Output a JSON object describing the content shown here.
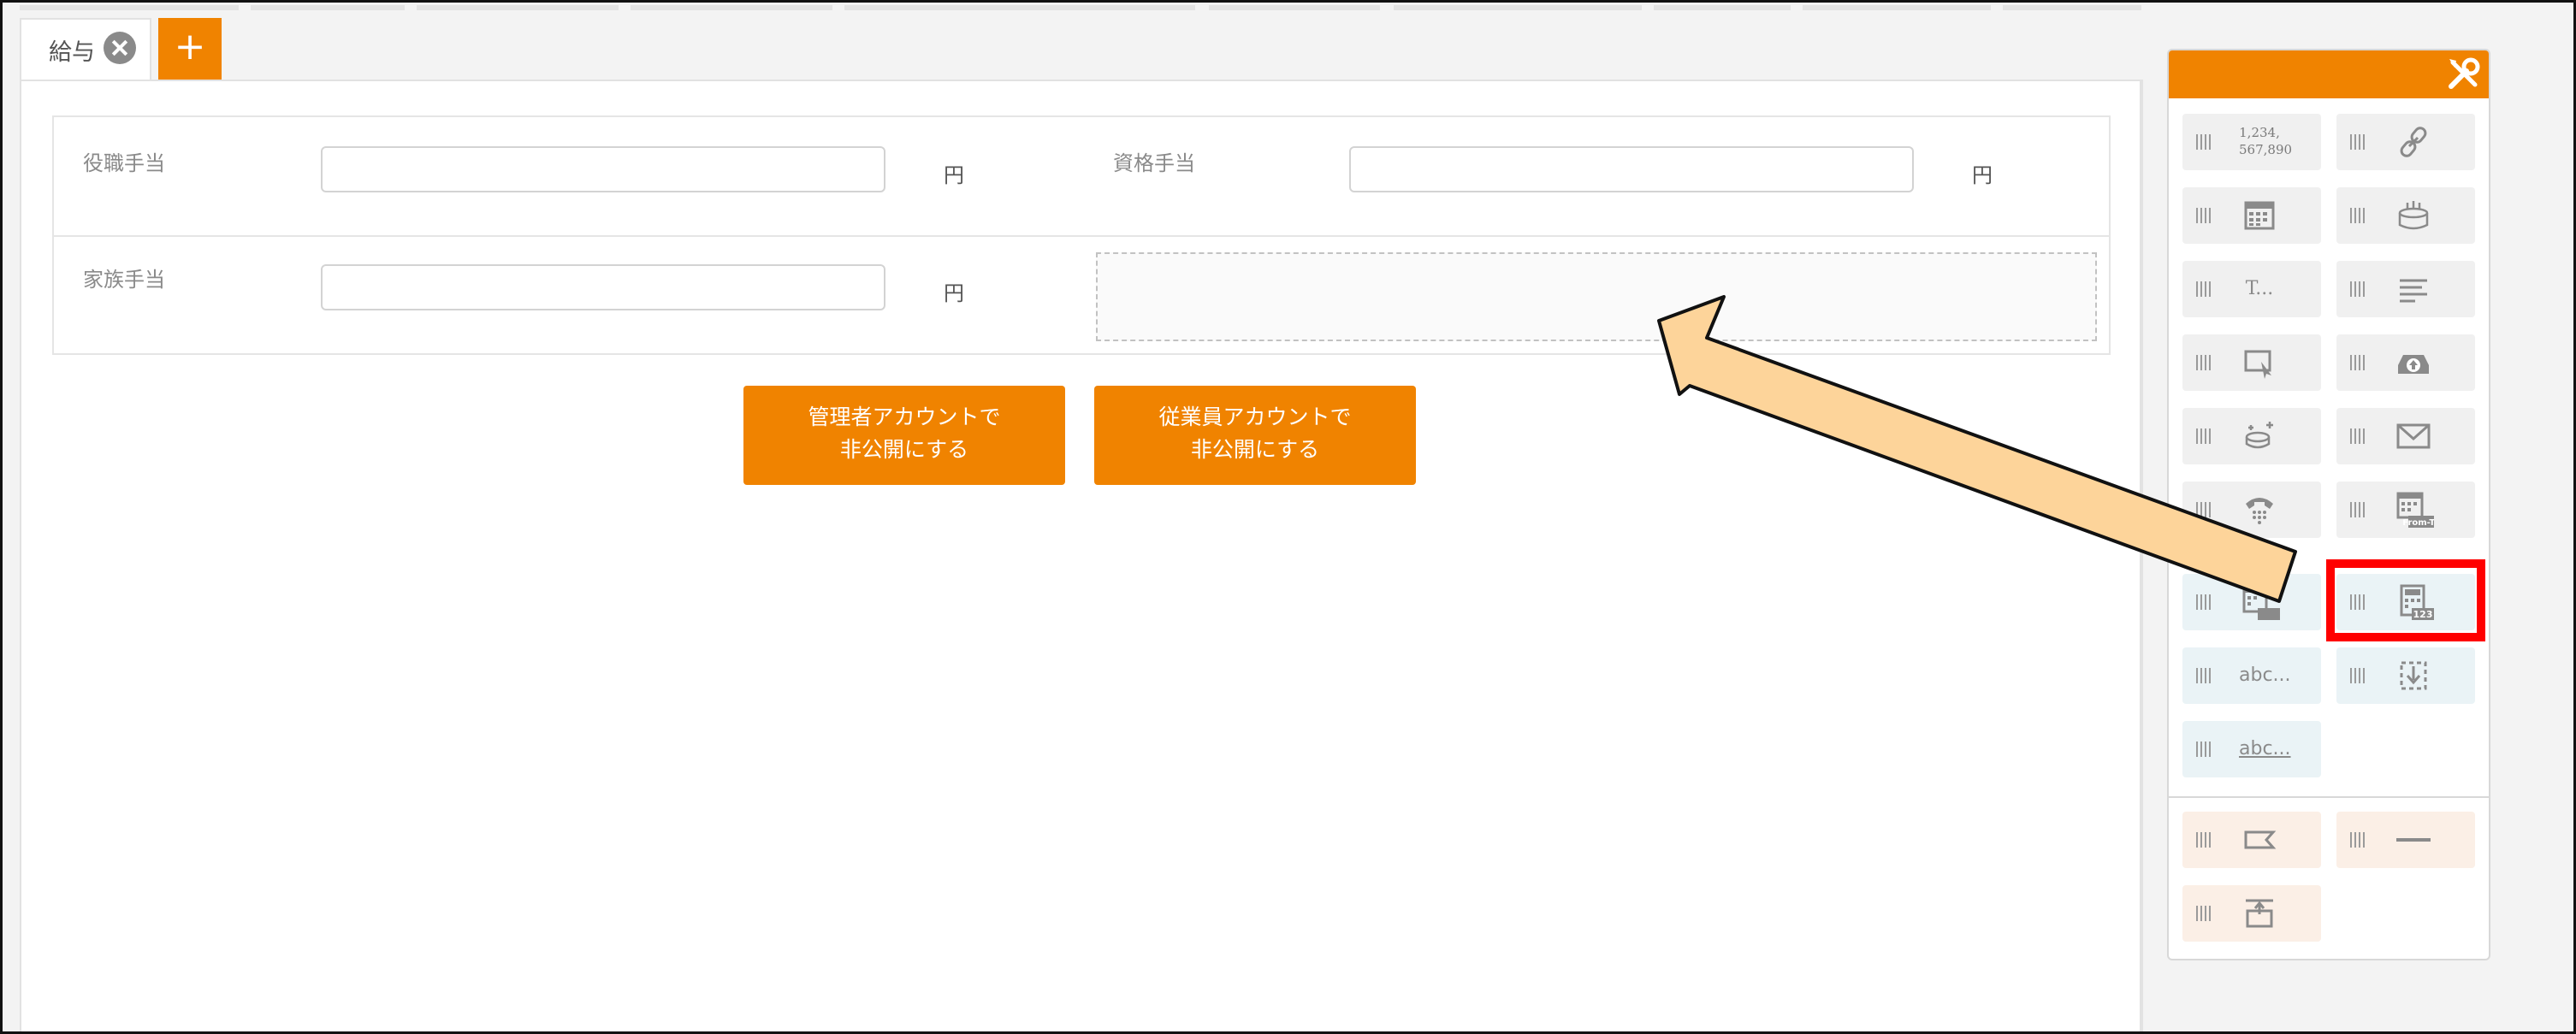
{
  "tabs": {
    "active_label": "給与",
    "add_label": "+"
  },
  "fields": [
    {
      "label": "役職手当",
      "unit": "円"
    },
    {
      "label": "資格手当",
      "unit": "円"
    },
    {
      "label": "家族手当",
      "unit": "円"
    }
  ],
  "buttons": {
    "admin_hide": [
      "管理者アカウントで",
      "非公開にする"
    ],
    "employee_hide": [
      "従業員アカウントで",
      "非公開にする"
    ]
  },
  "toolbox": {
    "header_icon": "wrench-screwdriver-icon",
    "number_format_text": [
      "1,234,",
      "567,890"
    ],
    "text_field_text": "T...",
    "abc_text": "abc...",
    "abc_link_text": "abc...",
    "from_to_text": "From-To",
    "calc_badge_text": "123",
    "tools": [
      {
        "name": "number-format-tool",
        "icon": "number-format-icon",
        "tint": "gray"
      },
      {
        "name": "link-tool",
        "icon": "link-icon",
        "tint": "gray"
      },
      {
        "name": "date-tool",
        "icon": "calendar-icon",
        "tint": "gray"
      },
      {
        "name": "birthday-tool",
        "icon": "cake-icon",
        "tint": "gray"
      },
      {
        "name": "text-tool",
        "icon": "text-icon",
        "tint": "gray"
      },
      {
        "name": "textarea-tool",
        "icon": "paragraph-icon",
        "tint": "gray"
      },
      {
        "name": "select-tool",
        "icon": "select-cursor-icon",
        "tint": "gray"
      },
      {
        "name": "file-upload-tool",
        "icon": "upload-tray-icon",
        "tint": "gray"
      },
      {
        "name": "currency-tool",
        "icon": "coins-icon",
        "tint": "gray"
      },
      {
        "name": "email-tool",
        "icon": "envelope-icon",
        "tint": "gray"
      },
      {
        "name": "phone-tool",
        "icon": "telephone-icon",
        "tint": "gray"
      },
      {
        "name": "date-range-tool",
        "icon": "calendar-range-icon",
        "tint": "gray"
      },
      {
        "name": "date-calc-tool",
        "icon": "calendar-calc-icon",
        "tint": "blue"
      },
      {
        "name": "calculation-tool",
        "icon": "calculator-icon",
        "tint": "blue"
      },
      {
        "name": "label-text-tool",
        "icon": "abc-icon",
        "tint": "blue"
      },
      {
        "name": "import-tool",
        "icon": "download-box-icon",
        "tint": "blue"
      },
      {
        "name": "linked-text-tool",
        "icon": "abc-link-icon",
        "tint": "blue"
      },
      {
        "name": "tag-tool",
        "icon": "tag-icon",
        "tint": "peach"
      },
      {
        "name": "separator-tool",
        "icon": "horizontal-line-icon",
        "tint": "peach"
      },
      {
        "name": "section-tool",
        "icon": "section-icon",
        "tint": "peach"
      }
    ]
  },
  "annotation": {
    "highlight_color": "#ff0000",
    "arrow_fill": "#fdd49a",
    "accent": "#f08300"
  }
}
